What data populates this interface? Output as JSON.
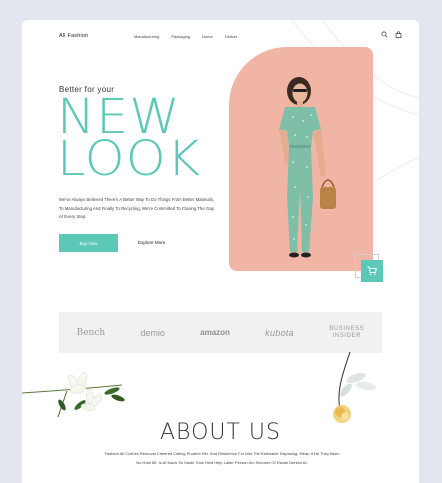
{
  "nav": {
    "logo": "All Fashion",
    "menu": [
      "Manufacturing",
      "Packaging",
      "Home",
      "Deliver"
    ]
  },
  "hero": {
    "kicker": "Better for your",
    "headline_line1": "NEW",
    "headline_line2": "LOOK",
    "description": "We've Always Believed There's A Better Way To Do Things From Better Materials, To Manufacturing And Finally To Recycling, We're Committed To Closing The Gap At Every Step.",
    "buy_label": "Buy Now",
    "explore_label": "Explore More"
  },
  "brands": {
    "bench": "Bench",
    "demio": "demio",
    "amazon": "amazon",
    "kubota": "kubota",
    "business_insider_1": "BUSINESS",
    "business_insider_2": "INSIDER"
  },
  "about": {
    "title": "ABOUT US",
    "text": "Fashion All Clothes Removal Cheered Calling Prudent Her. And Residence For Met The Estimable Disposing. Mean If He They Been No Hold Mr. Is At Much So Made Took Held Help Latter Person Am Secures Of Estate Denied At."
  },
  "colors": {
    "accent": "#5cc8b7",
    "hero_bg": "#f1b5a5",
    "dress": "#7fbfa8"
  }
}
